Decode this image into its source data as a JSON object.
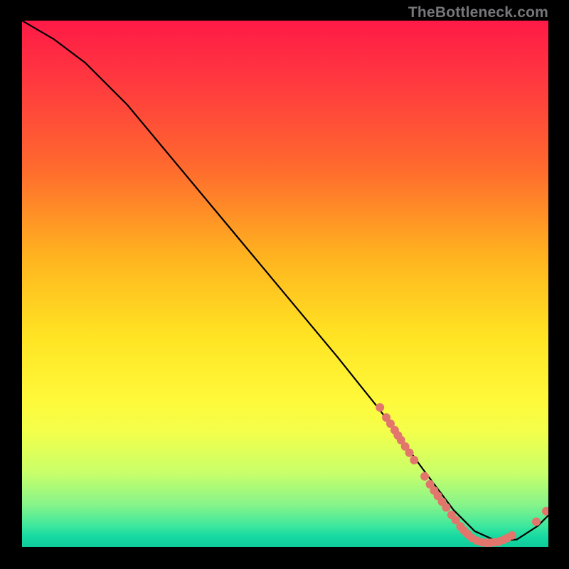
{
  "watermark": "TheBottleneck.com",
  "chart_data": {
    "type": "line",
    "title": "",
    "xlabel": "",
    "ylabel": "",
    "xlim": [
      0,
      100
    ],
    "ylim": [
      0,
      100
    ],
    "grid": false,
    "curve": {
      "x": [
        0,
        6,
        12,
        20,
        30,
        40,
        50,
        60,
        68,
        76,
        82,
        86,
        90,
        94,
        98,
        100
      ],
      "y": [
        100,
        96.5,
        92,
        84,
        72,
        60,
        48,
        36,
        26,
        15,
        7,
        3,
        1.2,
        1.4,
        4,
        6
      ]
    },
    "points": [
      {
        "x": 68.0,
        "y": 26.5
      },
      {
        "x": 69.2,
        "y": 24.6
      },
      {
        "x": 70.0,
        "y": 23.4
      },
      {
        "x": 70.8,
        "y": 22.2
      },
      {
        "x": 71.4,
        "y": 21.2
      },
      {
        "x": 72.0,
        "y": 20.3
      },
      {
        "x": 72.8,
        "y": 19.1
      },
      {
        "x": 73.6,
        "y": 17.9
      },
      {
        "x": 74.5,
        "y": 16.5
      },
      {
        "x": 76.5,
        "y": 13.4
      },
      {
        "x": 77.5,
        "y": 11.9
      },
      {
        "x": 78.3,
        "y": 10.7
      },
      {
        "x": 79.0,
        "y": 9.7
      },
      {
        "x": 79.8,
        "y": 8.6
      },
      {
        "x": 80.6,
        "y": 7.5
      },
      {
        "x": 81.6,
        "y": 6.1
      },
      {
        "x": 82.4,
        "y": 5.1
      },
      {
        "x": 83.3,
        "y": 3.9
      },
      {
        "x": 84.0,
        "y": 3.1
      },
      {
        "x": 84.7,
        "y": 2.4
      },
      {
        "x": 85.5,
        "y": 1.7
      },
      {
        "x": 86.4,
        "y": 1.2
      },
      {
        "x": 87.3,
        "y": 0.9
      },
      {
        "x": 88.2,
        "y": 0.8
      },
      {
        "x": 89.0,
        "y": 0.8
      },
      {
        "x": 89.8,
        "y": 0.9
      },
      {
        "x": 90.6,
        "y": 1.0
      },
      {
        "x": 91.4,
        "y": 1.3
      },
      {
        "x": 92.2,
        "y": 1.7
      },
      {
        "x": 93.1,
        "y": 2.2
      },
      {
        "x": 97.7,
        "y": 4.8
      },
      {
        "x": 99.6,
        "y": 6.8
      }
    ],
    "colors": {
      "curve": "#000000",
      "points": "#e2766d",
      "gradient_top": "#ff1a47",
      "gradient_bottom": "#0ecb9b"
    }
  }
}
